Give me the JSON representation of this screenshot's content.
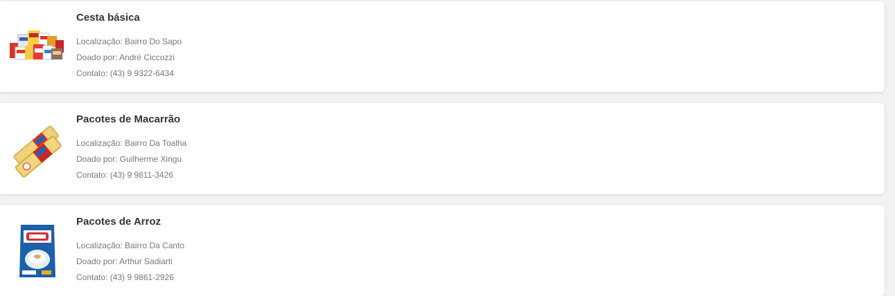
{
  "donations": [
    {
      "title": "Cesta básica",
      "location": "Localização: Bairro Do Sapo",
      "donor": "Doado por: André Ciccozzi",
      "contact": "Contato: (43) 9 9322-6434",
      "image_icon": "grocery-basket-icon"
    },
    {
      "title": "Pacotes de Macarrão",
      "location": "Localização: Bairro Da Toalha",
      "donor": "Doado por: Guilherme Xingu",
      "contact": "Contato: (43) 9 9811-3426",
      "image_icon": "pasta-package-icon"
    },
    {
      "title": "Pacotes de Arroz",
      "location": "Localização: Bairro Da Canto",
      "donor": "Doado por: Arthur Sadiarti",
      "contact": "Contato: (43) 9 9861-2926",
      "image_icon": "rice-package-icon"
    }
  ],
  "colors": {
    "background": "#f2f2f2",
    "card": "#ffffff",
    "title": "#333333",
    "text": "#777777"
  }
}
